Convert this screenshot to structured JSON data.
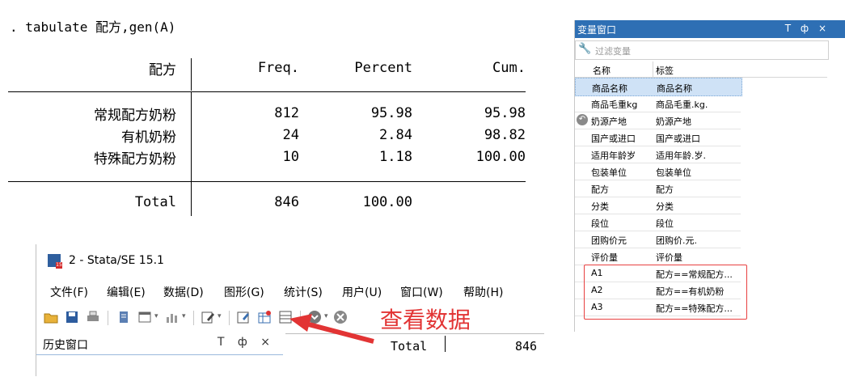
{
  "tabulate": {
    "command": ". tabulate 配方,gen(A)",
    "var_header": "配方",
    "columns": [
      "Freq.",
      "Percent",
      "Cum."
    ],
    "rows": [
      {
        "label": "常规配方奶粉",
        "freq": "812",
        "percent": "95.98",
        "cum": "95.98"
      },
      {
        "label": "有机奶粉",
        "freq": "24",
        "percent": "2.84",
        "cum": "98.82"
      },
      {
        "label": "特殊配方奶粉",
        "freq": "10",
        "percent": "1.18",
        "cum": "100.00"
      }
    ],
    "total": {
      "label": "Total",
      "freq": "846",
      "percent": "100.00"
    }
  },
  "variables_window": {
    "title": "变量窗口",
    "title_buttons": "T ф ×",
    "filter_placeholder": "过滤变量",
    "col_name": "名称",
    "col_label": "标签",
    "variables": [
      {
        "name": "商品名称",
        "label": "商品名称",
        "selected": true
      },
      {
        "name": "商品毛重kg",
        "label": "商品毛重.kg."
      },
      {
        "name": "奶源产地",
        "label": "奶源产地"
      },
      {
        "name": "国产或进口",
        "label": "国产或进口"
      },
      {
        "name": "适用年龄岁",
        "label": "适用年龄.岁."
      },
      {
        "name": "包装单位",
        "label": "包装单位"
      },
      {
        "name": "配方",
        "label": "配方"
      },
      {
        "name": "分类",
        "label": "分类"
      },
      {
        "name": "段位",
        "label": "段位"
      },
      {
        "name": "团购价元",
        "label": "团购价.元."
      },
      {
        "name": "评价量",
        "label": "评价量"
      },
      {
        "name": "A1",
        "label": "配方==常规配方..."
      },
      {
        "name": "A2",
        "label": "配方==有机奶粉"
      },
      {
        "name": "A3",
        "label": "配方==特殊配方..."
      }
    ]
  },
  "stata_window": {
    "title": "2 - Stata/SE 15.1",
    "menus": [
      "文件(F)",
      "编辑(E)",
      "数据(D)",
      "图形(G)",
      "统计(S)",
      "用户(U)",
      "窗口(W)",
      "帮助(H)"
    ],
    "history_title": "历史窗口",
    "history_buttons": "T ф ×",
    "results_total_label": "Total",
    "results_total_value": "846"
  },
  "annotation": "查看数据",
  "colors": {
    "accent": "#2e6fb4",
    "annotation": "#e23434",
    "selection": "#cfe2f6"
  }
}
